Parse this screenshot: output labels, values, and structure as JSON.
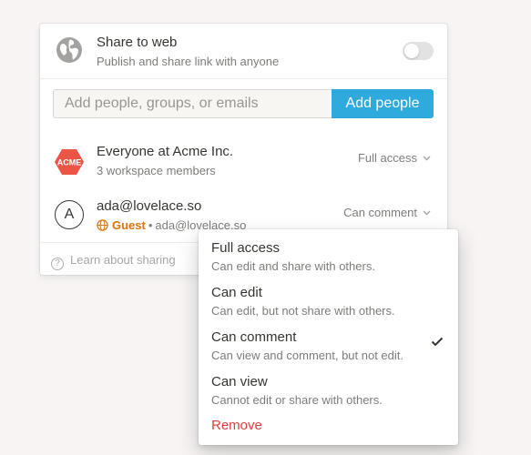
{
  "share_web": {
    "title": "Share to web",
    "subtitle": "Publish and share link with anyone",
    "icon": "globe-icon",
    "enabled": false
  },
  "invite": {
    "placeholder": "Add people, groups, or emails",
    "button_label": "Add people",
    "button_color": "#2eaadc"
  },
  "members": [
    {
      "badge_text": "ACME",
      "badge_color": "#eb5545",
      "name": "Everyone at Acme Inc.",
      "subtitle": "3 workspace members",
      "permission": "Full access"
    },
    {
      "avatar_letter": "A",
      "name": "ada@lovelace.so",
      "role_label": "Guest",
      "role_color": "#d9730d",
      "separator": "•",
      "email": "ada@lovelace.so",
      "permission": "Can comment"
    }
  ],
  "footer": {
    "learn_label": "Learn about sharing",
    "icon": "question-icon"
  },
  "permission_menu": {
    "items": [
      {
        "title": "Full access",
        "description": "Can edit and share with others.",
        "selected": false
      },
      {
        "title": "Can edit",
        "description": "Can edit, but not share with others.",
        "selected": false
      },
      {
        "title": "Can comment",
        "description": "Can view and comment, but not edit.",
        "selected": true
      },
      {
        "title": "Can view",
        "description": "Cannot edit or share with others.",
        "selected": false
      }
    ],
    "remove_label": "Remove",
    "remove_color": "#e03e3e"
  }
}
